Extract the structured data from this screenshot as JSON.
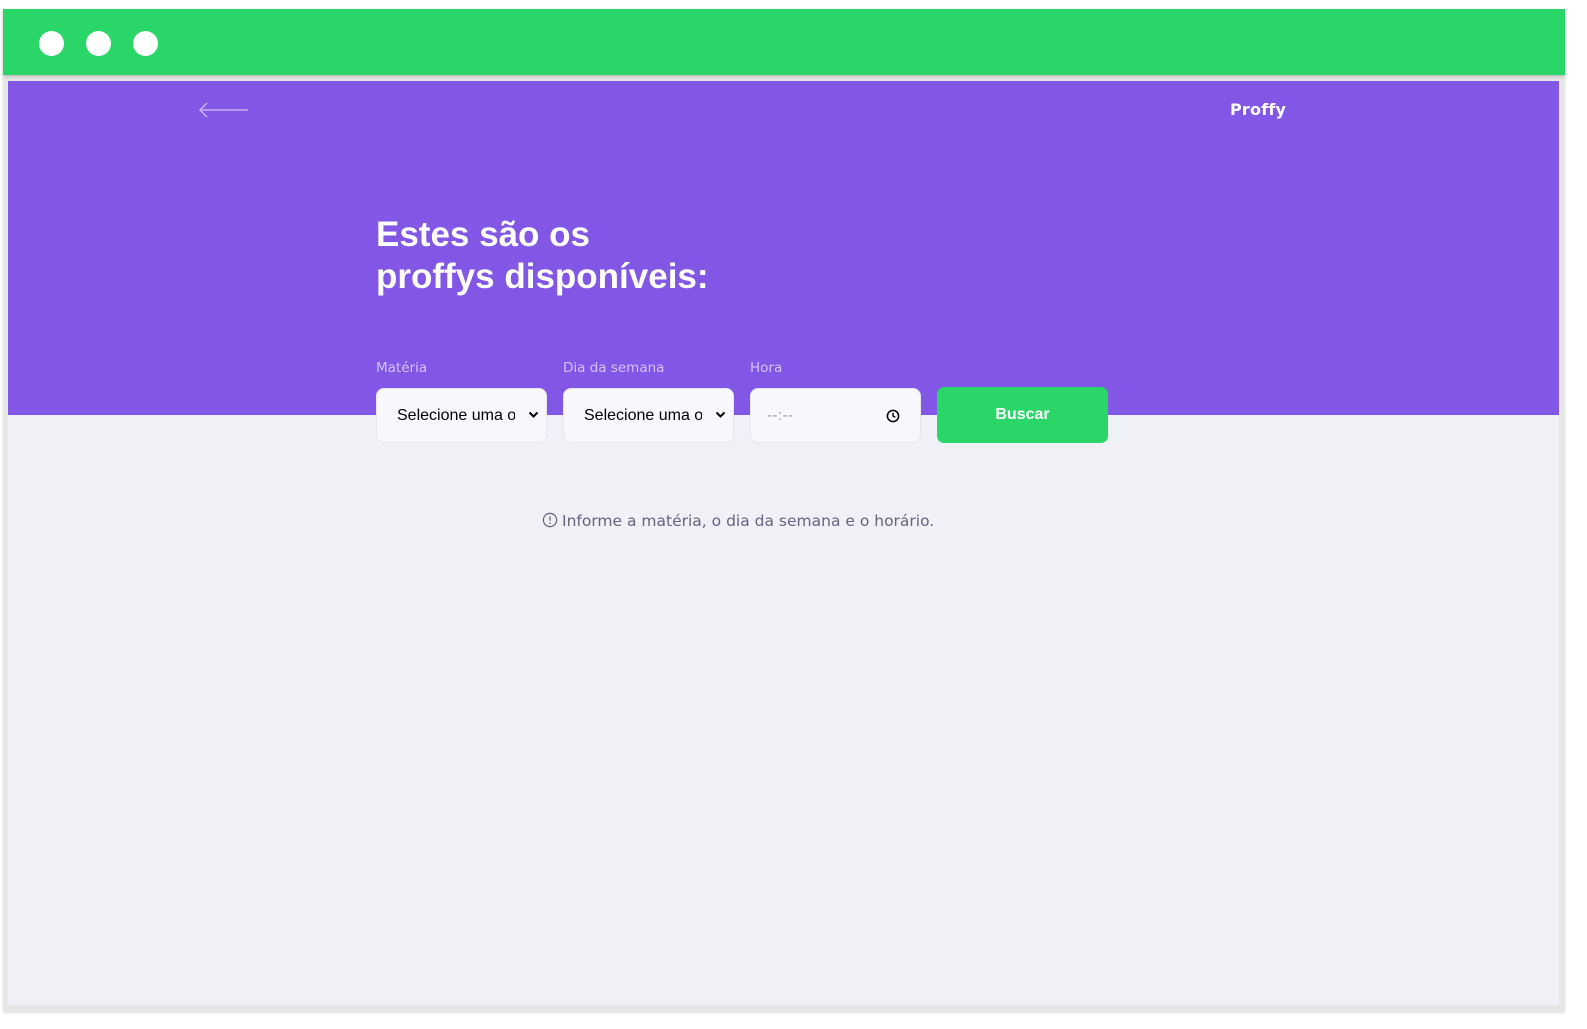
{
  "window": {
    "controls": [
      "close-dot",
      "minimize-dot",
      "maximize-dot"
    ]
  },
  "header": {
    "back_icon": "arrow-left-icon",
    "brand": "Proffy"
  },
  "page": {
    "title_line1": "Estes são os",
    "title_line2": "proffys disponíveis:"
  },
  "filters": {
    "subject": {
      "label": "Matéria",
      "value": "Selecione uma opção"
    },
    "weekday": {
      "label": "Dia da semana",
      "value": "Selecione uma opção"
    },
    "time": {
      "label": "Hora",
      "value": "--:--"
    },
    "search_label": "Buscar"
  },
  "info": {
    "icon": "alert-circle-icon",
    "text": "Informe a matéria, o dia da semana e o horário."
  },
  "colors": {
    "titlebar": "#2bd669",
    "primary": "#8257e5",
    "secondary": "#2bd669",
    "background": "#f0f0f7"
  }
}
